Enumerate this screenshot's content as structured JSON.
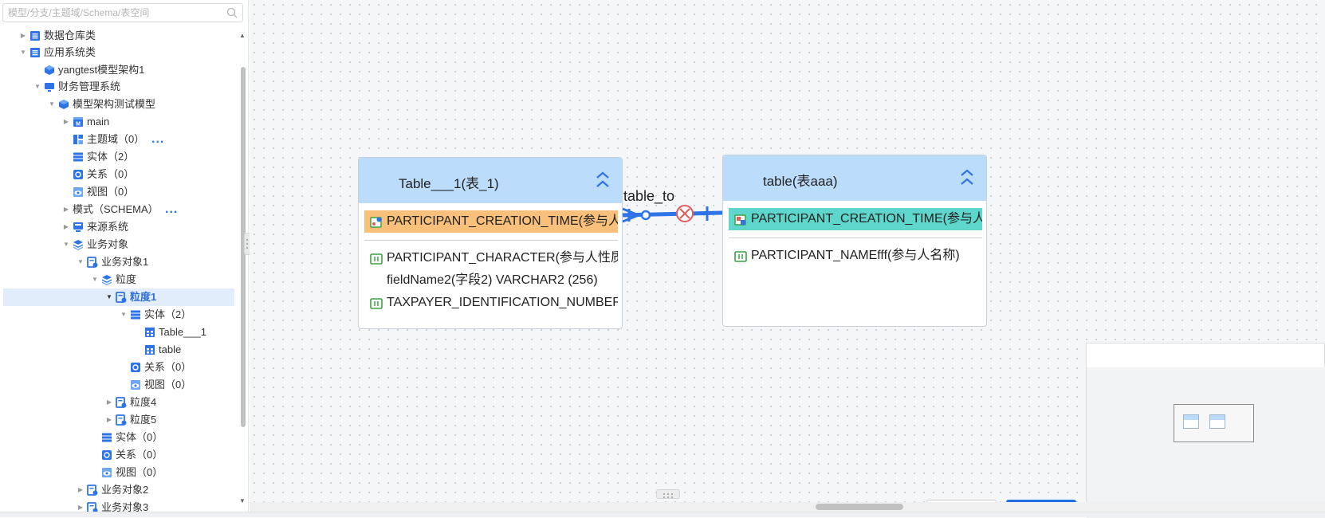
{
  "search": {
    "placeholder": "模型/分支/主题域/Schema/表空间"
  },
  "tree": {
    "items": [
      {
        "label": "数据仓库类",
        "icon": "catalog-icon"
      },
      {
        "label": "应用系统类",
        "icon": "catalog-icon"
      },
      {
        "label": "yangtest模型架构1",
        "icon": "cube-icon"
      },
      {
        "label": "财务管理系统",
        "icon": "monitor-icon"
      },
      {
        "label": "模型架构测试模型",
        "icon": "cube-icon"
      },
      {
        "label": "main",
        "icon": "model-m-icon"
      },
      {
        "label": "主题域（0）",
        "icon": "subject-area-icon",
        "more": "..."
      },
      {
        "label": "实体（2）",
        "icon": "entity-list-icon"
      },
      {
        "label": "关系（0）",
        "icon": "relation-icon"
      },
      {
        "label": "视图（0）",
        "icon": "view-icon"
      },
      {
        "label": "模式（SCHEMA）",
        "icon": "",
        "more": "..."
      },
      {
        "label": "来源系统",
        "icon": "source-system-icon"
      },
      {
        "label": "业务对象",
        "icon": "layers-icon"
      },
      {
        "label": "业务对象1",
        "icon": "business-object-icon"
      },
      {
        "label": "粒度",
        "icon": "layers-icon"
      },
      {
        "label": "粒度1",
        "icon": "business-object-icon"
      },
      {
        "label": "实体（2）",
        "icon": "entity-list-icon"
      },
      {
        "label": "Table___1",
        "icon": "table-icon"
      },
      {
        "label": "table",
        "icon": "table-icon"
      },
      {
        "label": "关系（0）",
        "icon": "relation-icon"
      },
      {
        "label": "视图（0）",
        "icon": "view-icon"
      },
      {
        "label": "粒度4",
        "icon": "business-object-icon"
      },
      {
        "label": "粒度5",
        "icon": "business-object-icon"
      },
      {
        "label": "实体（0）",
        "icon": "entity-list-icon"
      },
      {
        "label": "关系（0）",
        "icon": "relation-icon"
      },
      {
        "label": "视图（0）",
        "icon": "view-icon"
      },
      {
        "label": "业务对象2",
        "icon": "business-object-icon"
      },
      {
        "label": "业务对象3",
        "icon": "business-object-icon"
      }
    ]
  },
  "diagram": {
    "relationship_label": "table_to",
    "table1": {
      "title": "Table___1(表_1)",
      "pk_field": "PARTICIPANT_CREATION_TIME(参与人创建时间)",
      "fields": [
        "PARTICIPANT_CHARACTER(参与人性质)",
        "fieldName2(字段2) VARCHAR2 (256)",
        "TAXPAYER_IDENTIFICATION_NUMBER"
      ]
    },
    "table2": {
      "title": "table(表aaa)",
      "pk_field": "PARTICIPANT_CREATION_TIME(参与人创建时间)",
      "fields": [
        "PARTICIPANT_NAMEfff(参与人名称)"
      ]
    }
  },
  "colors": {
    "accent": "#2f74e6",
    "table_header": "#bcdcfb",
    "pk_field_table1": "#f9c07c",
    "pk_field_table2": "#5ed6cc",
    "selected_row": "#e2edfc"
  }
}
